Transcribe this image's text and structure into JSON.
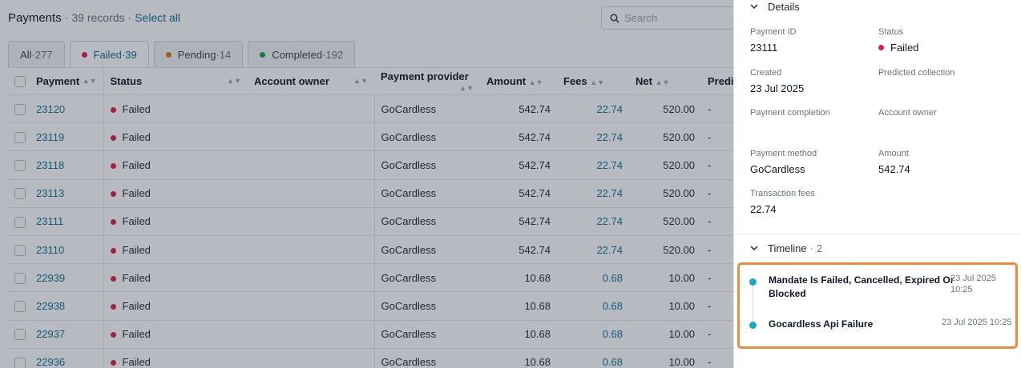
{
  "header": {
    "title": "Payments",
    "separator": "·",
    "records": "39 records",
    "separator2": "·",
    "select_all": "Select all",
    "search_placeholder": "Search"
  },
  "tabs": [
    {
      "label": "All",
      "count": "277",
      "sep": " · "
    },
    {
      "label": "Failed",
      "count": "39",
      "sep": " · ",
      "dot_color": "#e11d48"
    },
    {
      "label": "Pending",
      "count": "14",
      "sep": " · ",
      "dot_color": "#d97706"
    },
    {
      "label": "Completed",
      "count": "192",
      "sep": " · ",
      "dot_color": "#16a34a"
    }
  ],
  "table": {
    "columns": [
      "Payment",
      "Status",
      "Account owner",
      "Payment provider",
      "Amount",
      "Fees",
      "Net",
      "Predi"
    ],
    "rows": [
      {
        "id": "23120",
        "status": "Failed",
        "owner": "",
        "provider": "GoCardless",
        "amount": "542.74",
        "fees": "22.74",
        "net": "520.00",
        "pred": "-"
      },
      {
        "id": "23119",
        "status": "Failed",
        "owner": "",
        "provider": "GoCardless",
        "amount": "542.74",
        "fees": "22.74",
        "net": "520.00",
        "pred": "-"
      },
      {
        "id": "23118",
        "status": "Failed",
        "owner": "",
        "provider": "GoCardless",
        "amount": "542.74",
        "fees": "22.74",
        "net": "520.00",
        "pred": "-"
      },
      {
        "id": "23113",
        "status": "Failed",
        "owner": "",
        "provider": "GoCardless",
        "amount": "542.74",
        "fees": "22.74",
        "net": "520.00",
        "pred": "-"
      },
      {
        "id": "23111",
        "status": "Failed",
        "owner": "",
        "provider": "GoCardless",
        "amount": "542.74",
        "fees": "22.74",
        "net": "520.00",
        "pred": "-"
      },
      {
        "id": "23110",
        "status": "Failed",
        "owner": "",
        "provider": "GoCardless",
        "amount": "542.74",
        "fees": "22.74",
        "net": "520.00",
        "pred": "-"
      },
      {
        "id": "22939",
        "status": "Failed",
        "owner": "",
        "provider": "GoCardless",
        "amount": "10.68",
        "fees": "0.68",
        "net": "10.00",
        "pred": "-"
      },
      {
        "id": "22938",
        "status": "Failed",
        "owner": "",
        "provider": "GoCardless",
        "amount": "10.68",
        "fees": "0.68",
        "net": "10.00",
        "pred": "-"
      },
      {
        "id": "22937",
        "status": "Failed",
        "owner": "",
        "provider": "GoCardless",
        "amount": "10.68",
        "fees": "0.68",
        "net": "10.00",
        "pred": "-"
      },
      {
        "id": "22936",
        "status": "Failed",
        "owner": "",
        "provider": "GoCardless",
        "amount": "10.68",
        "fees": "0.68",
        "net": "10.00",
        "pred": "-"
      }
    ]
  },
  "panel": {
    "details_title": "Details",
    "fields": {
      "payment_id_label": "Payment ID",
      "payment_id": "23111",
      "status_label": "Status",
      "status": "Failed",
      "created_label": "Created",
      "created": "23 Jul 2025",
      "predicted_label": "Predicted collection",
      "predicted": "",
      "completion_label": "Payment completion",
      "completion": "",
      "owner_label": "Account owner",
      "owner": "",
      "method_label": "Payment method",
      "method": "GoCardless",
      "amount_label": "Amount",
      "amount": "542.74",
      "fees_label": "Transaction fees",
      "fees": "22.74"
    },
    "timeline_title": "Timeline",
    "timeline_sep": "·",
    "timeline_count": "2",
    "timeline": [
      {
        "title_line1": "Mandate Is Failed, Cancelled, Expired Or",
        "title_line2": "Blocked",
        "time_line1": "23 Jul 2025",
        "time_line2": "10:25"
      },
      {
        "title_line1": "Gocardless Api Failure",
        "time_line1": "23 Jul 2025 10:25"
      }
    ]
  },
  "colors": {
    "accent": "#0e7490",
    "failed": "#e11d48",
    "timeline_dot": "#1aa8c4",
    "highlight_border": "#f08a3c"
  }
}
